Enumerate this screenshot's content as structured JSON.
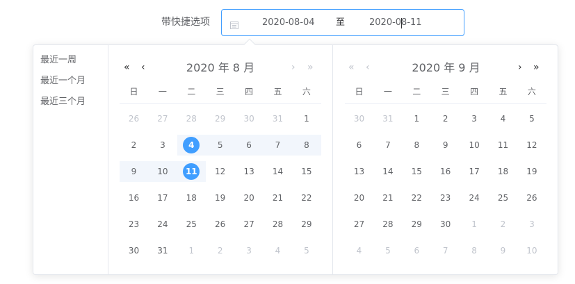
{
  "label": "带快捷选项",
  "input": {
    "start": "2020-08-04",
    "separator": "至",
    "end": "2020-08-11"
  },
  "shortcuts": [
    "最近一周",
    "最近一个月",
    "最近三个月"
  ],
  "weekdays": [
    "日",
    "一",
    "二",
    "三",
    "四",
    "五",
    "六"
  ],
  "nav": {
    "prev_year": "«",
    "prev_month": "‹",
    "next_month": "›",
    "next_year": "»"
  },
  "left_panel": {
    "title": "2020 年 8 月",
    "rows": [
      [
        {
          "d": "26",
          "o": true
        },
        {
          "d": "27",
          "o": true
        },
        {
          "d": "28",
          "o": true
        },
        {
          "d": "29",
          "o": true
        },
        {
          "d": "30",
          "o": true
        },
        {
          "d": "31",
          "o": true
        },
        {
          "d": "1"
        }
      ],
      [
        {
          "d": "2"
        },
        {
          "d": "3"
        },
        {
          "d": "4",
          "s": true,
          "r": true
        },
        {
          "d": "5",
          "r": true
        },
        {
          "d": "6",
          "r": true
        },
        {
          "d": "7",
          "r": true
        },
        {
          "d": "8",
          "r": true
        }
      ],
      [
        {
          "d": "9",
          "r": true
        },
        {
          "d": "10",
          "r": true
        },
        {
          "d": "11",
          "s": true,
          "r": true
        },
        {
          "d": "12"
        },
        {
          "d": "13"
        },
        {
          "d": "14"
        },
        {
          "d": "15"
        }
      ],
      [
        {
          "d": "16"
        },
        {
          "d": "17"
        },
        {
          "d": "18"
        },
        {
          "d": "19"
        },
        {
          "d": "20"
        },
        {
          "d": "21"
        },
        {
          "d": "22"
        }
      ],
      [
        {
          "d": "23"
        },
        {
          "d": "24"
        },
        {
          "d": "25"
        },
        {
          "d": "26"
        },
        {
          "d": "27"
        },
        {
          "d": "28"
        },
        {
          "d": "29"
        }
      ],
      [
        {
          "d": "30"
        },
        {
          "d": "31"
        },
        {
          "d": "1",
          "o": true
        },
        {
          "d": "2",
          "o": true
        },
        {
          "d": "3",
          "o": true
        },
        {
          "d": "4",
          "o": true
        },
        {
          "d": "5",
          "o": true
        }
      ]
    ]
  },
  "right_panel": {
    "title": "2020 年 9 月",
    "rows": [
      [
        {
          "d": "30",
          "o": true
        },
        {
          "d": "31",
          "o": true
        },
        {
          "d": "1"
        },
        {
          "d": "2"
        },
        {
          "d": "3"
        },
        {
          "d": "4"
        },
        {
          "d": "5"
        }
      ],
      [
        {
          "d": "6"
        },
        {
          "d": "7"
        },
        {
          "d": "8"
        },
        {
          "d": "9"
        },
        {
          "d": "10"
        },
        {
          "d": "11"
        },
        {
          "d": "12"
        }
      ],
      [
        {
          "d": "13"
        },
        {
          "d": "14"
        },
        {
          "d": "15"
        },
        {
          "d": "16"
        },
        {
          "d": "17"
        },
        {
          "d": "18"
        },
        {
          "d": "19"
        }
      ],
      [
        {
          "d": "20"
        },
        {
          "d": "21"
        },
        {
          "d": "22"
        },
        {
          "d": "23"
        },
        {
          "d": "24"
        },
        {
          "d": "25"
        },
        {
          "d": "26"
        }
      ],
      [
        {
          "d": "27"
        },
        {
          "d": "28"
        },
        {
          "d": "29"
        },
        {
          "d": "30"
        },
        {
          "d": "1",
          "o": true
        },
        {
          "d": "2",
          "o": true
        },
        {
          "d": "3",
          "o": true
        }
      ],
      [
        {
          "d": "4",
          "o": true
        },
        {
          "d": "5",
          "o": true
        },
        {
          "d": "6",
          "o": true
        },
        {
          "d": "7",
          "o": true
        },
        {
          "d": "8",
          "o": true
        },
        {
          "d": "9",
          "o": true
        },
        {
          "d": "10",
          "o": true
        }
      ]
    ]
  },
  "colors": {
    "accent": "#409eff",
    "range_bg": "#f2f6fc",
    "text": "#606266",
    "muted": "#c0c4cc"
  }
}
